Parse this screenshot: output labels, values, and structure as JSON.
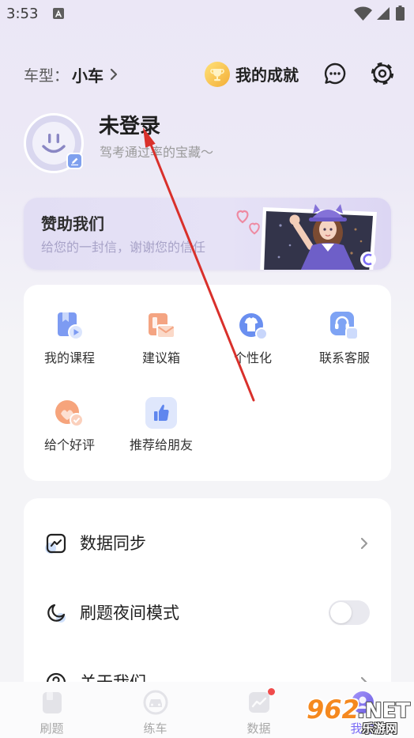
{
  "status_bar": {
    "time": "3:53",
    "icons": [
      "a-notification-icon",
      "wifi-icon",
      "signal-icon",
      "battery-icon"
    ]
  },
  "header": {
    "car_type_label": "车型：",
    "car_type_value": "小车",
    "achievement_label": "我的成就",
    "icons": [
      "chevron-right-icon",
      "trophy-icon",
      "message-icon",
      "settings-gear-icon"
    ]
  },
  "profile": {
    "name": "未登录",
    "subtitle": "驾考通过率的宝藏～",
    "avatar_icon": "smiley-avatar-icon",
    "badge_icon": "edit-icon"
  },
  "sponsor": {
    "title": "赞助我们",
    "subtitle": "给您的一封信，谢谢您的信任"
  },
  "shortcuts": [
    {
      "label": "我的课程",
      "icon": "course-icon"
    },
    {
      "label": "建议箱",
      "icon": "suggestion-box-icon"
    },
    {
      "label": "个性化",
      "icon": "personalize-icon"
    },
    {
      "label": "联系客服",
      "icon": "customer-service-icon"
    },
    {
      "label": "给个好评",
      "icon": "rate-icon"
    },
    {
      "label": "推荐给朋友",
      "icon": "thumbs-up-icon"
    }
  ],
  "settings": [
    {
      "label": "数据同步",
      "icon": "data-sync-icon",
      "trailing_icon": "chevron-right-icon"
    },
    {
      "label": "刷题夜间模式",
      "icon": "moon-icon",
      "toggle_on": false
    },
    {
      "label": "关于我们",
      "icon": "question-icon",
      "trailing_icon": "chevron-right-icon"
    }
  ],
  "bottom_nav": [
    {
      "label": "刷题",
      "icon": "practice-icon",
      "active": false
    },
    {
      "label": "练车",
      "icon": "car-icon",
      "active": false
    },
    {
      "label": "数据",
      "icon": "data-chart-icon",
      "active": false,
      "badge_dot": true
    },
    {
      "label": "我的",
      "icon": "profile-icon",
      "active": true
    }
  ],
  "watermark": {
    "logo_number": "962",
    "logo_suffix": ".NET",
    "site_name": "乐游网"
  },
  "colors": {
    "background_top": "#ebe7f6",
    "background": "#f4f4f7",
    "card": "#ffffff",
    "text_primary": "#222222",
    "text_secondary": "#9a9a9a",
    "accent_blue": "#6a8ff0",
    "accent_orange": "#f4a482",
    "accent_purple": "#7b6cf6",
    "badge_red": "#f04b4b",
    "annotation_arrow": "#d9302b"
  }
}
